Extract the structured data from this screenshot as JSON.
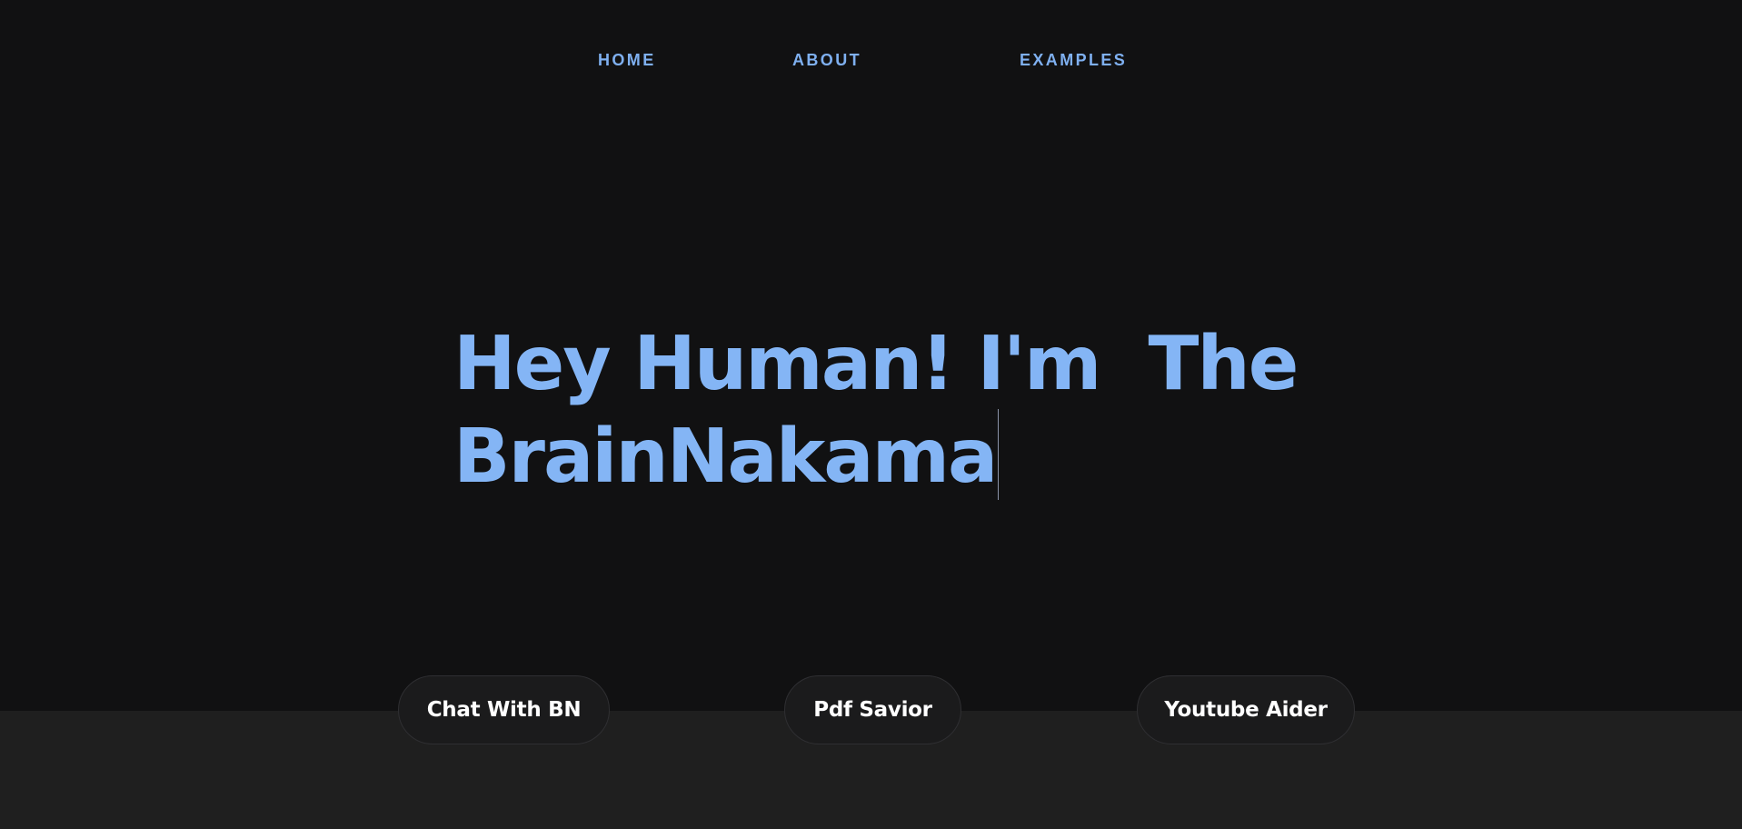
{
  "nav": {
    "home": "HOME",
    "about": "ABOUT",
    "examples": "EXAMPLES"
  },
  "hero": {
    "line1": "Hey Human! I'm  The",
    "line2": "BrainNakama"
  },
  "buttons": {
    "chat": "Chat With BN",
    "pdf": "Pdf Savior",
    "youtube": "Youtube Aider"
  },
  "colors": {
    "background": "#111112",
    "footer_band": "#1f1f1f",
    "accent": "#84b5f5",
    "button_bg": "#1b1b1c",
    "button_text": "#ffffff"
  }
}
